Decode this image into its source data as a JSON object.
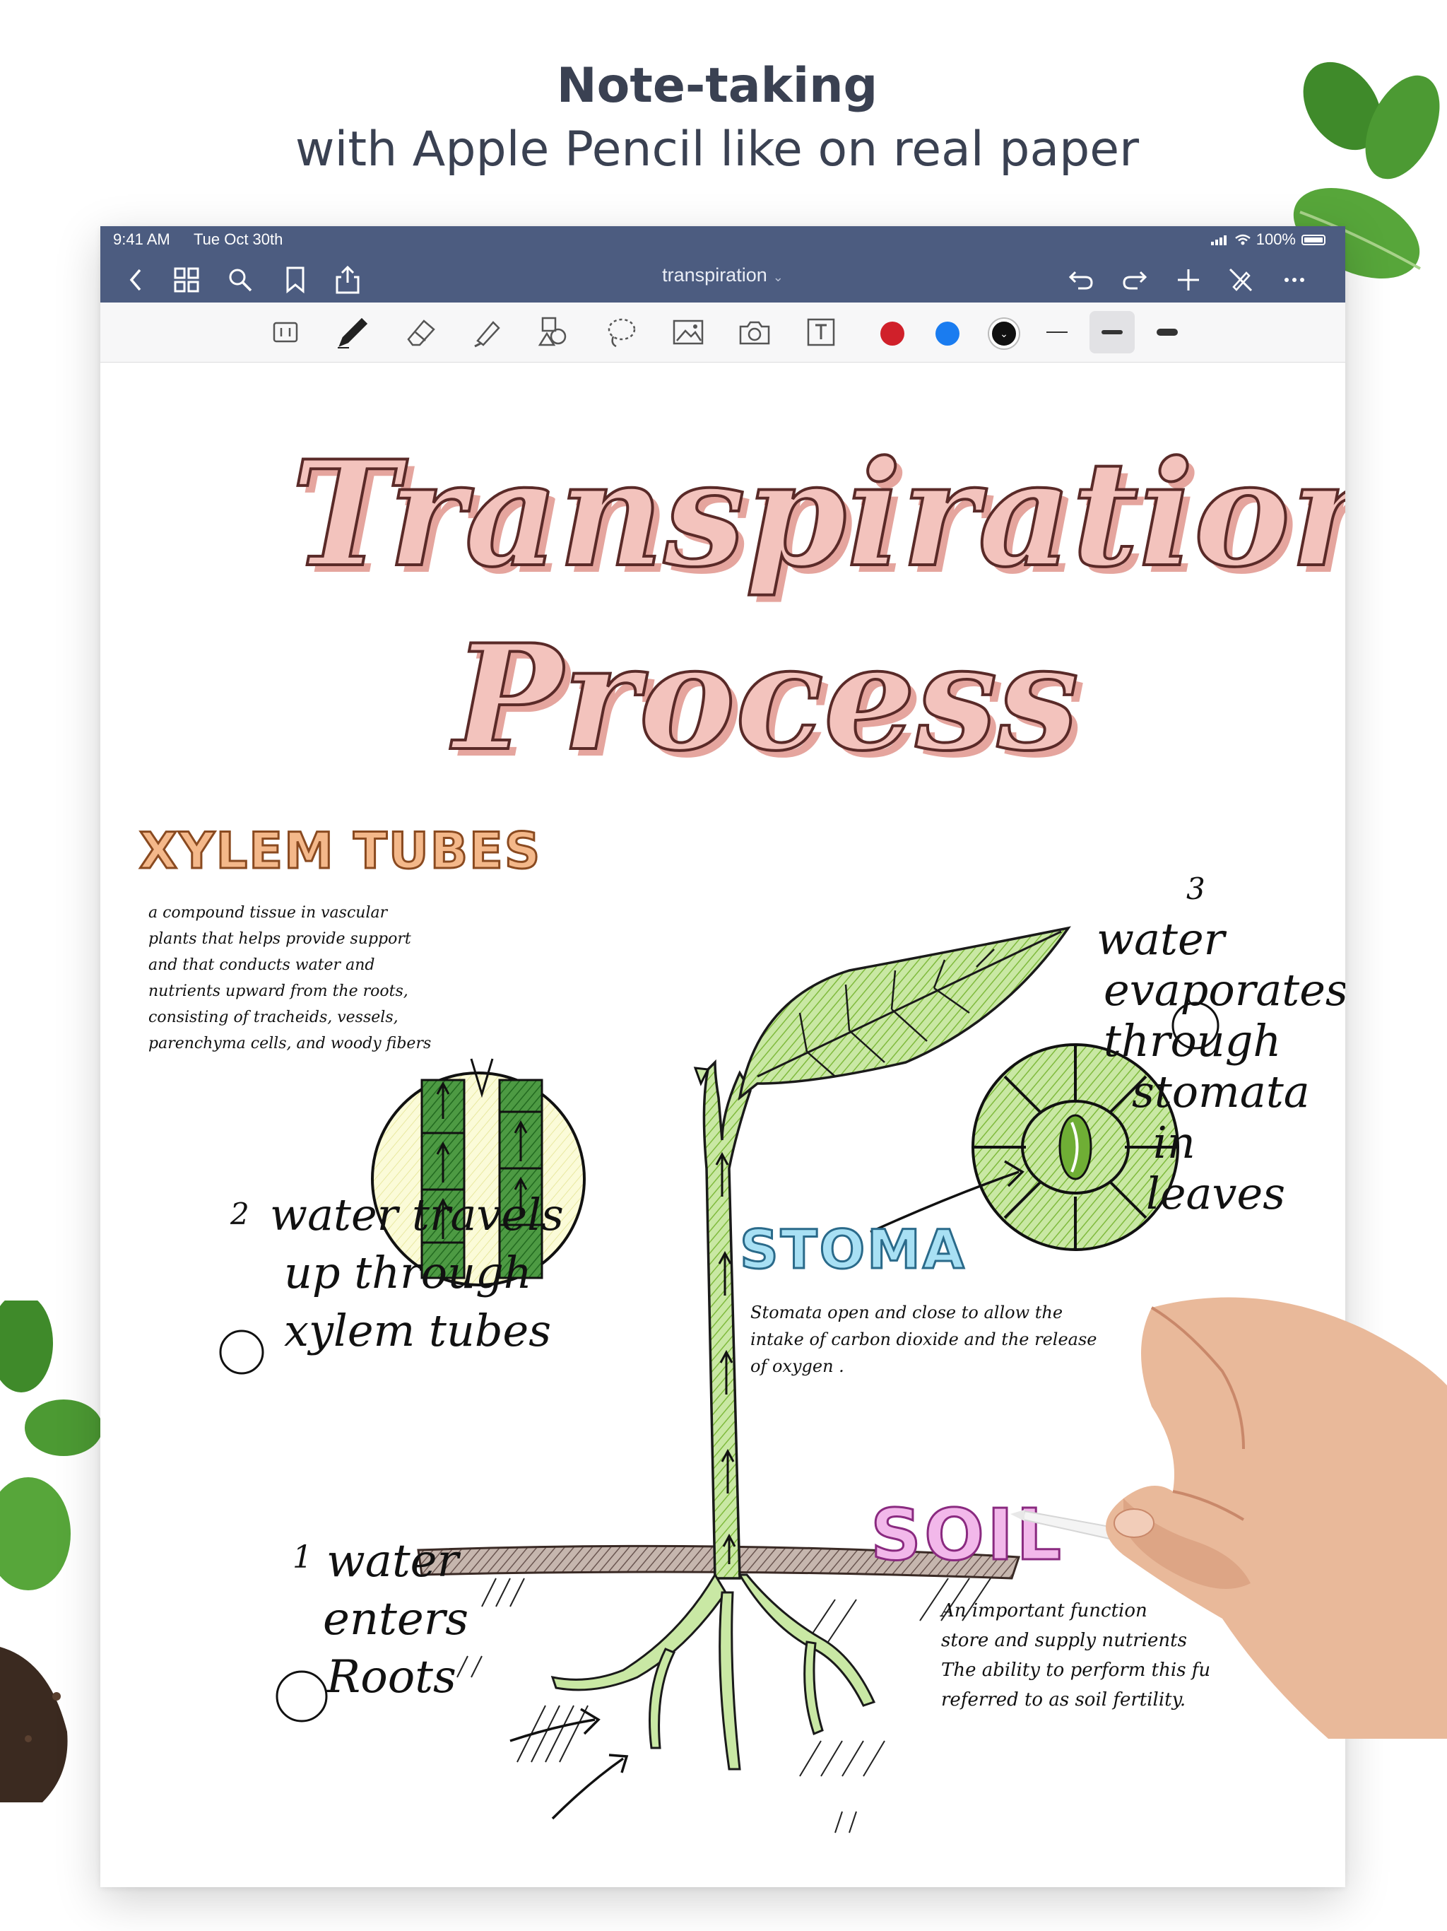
{
  "promo": {
    "title": "Note-taking",
    "subtitle": "with Apple Pencil like on real paper"
  },
  "statusbar": {
    "time": "9:41 AM",
    "date": "Tue Oct 30th",
    "battery": "100%"
  },
  "navbar": {
    "document_title": "transpiration",
    "left_icons": [
      "back-chevron-icon",
      "grid-icon",
      "search-icon",
      "bookmark-icon",
      "share-icon"
    ],
    "right_icons": [
      "undo-icon",
      "redo-icon",
      "add-icon",
      "pen-off-icon",
      "more-icon"
    ]
  },
  "tools": {
    "items": [
      "read-mode-icon",
      "pen-icon",
      "eraser-icon",
      "highlighter-icon",
      "shapes-icon",
      "lasso-icon",
      "image-icon",
      "camera-icon",
      "text-tool-icon"
    ],
    "colors": [
      "#d0202a",
      "#1a7cf0",
      "#111111"
    ],
    "selected_color": "#111111",
    "stroke_widths": [
      "thin",
      "medium",
      "thick"
    ],
    "selected_width": "medium"
  },
  "note": {
    "title_line1": "Transpiration",
    "title_line2": "Process",
    "xylem_heading": "XYLEM TUBES",
    "xylem_text": [
      "a compound tissue in vascular",
      "plants that helps provide support",
      "and that conducts water and",
      "nutrients upward from the roots,",
      "consisting of tracheids, vessels,",
      "parenchyma cells, and woody fibers"
    ],
    "step2_num": "2",
    "step2_text": [
      "water travels",
      "up through",
      "xylem tubes"
    ],
    "step3_num": "3",
    "step3_text": [
      "water",
      "evaporates",
      "through",
      "stomata",
      "in",
      "leaves"
    ],
    "stoma_heading": "STOMA",
    "stoma_text": [
      "Stomata open and close to allow the",
      "intake of carbon dioxide and the release",
      "of oxygen ."
    ],
    "step1_num": "1",
    "step1_text": [
      "water",
      "enters",
      "Roots"
    ],
    "soil_heading": "SOIL",
    "soil_text": [
      "An important function",
      "store and supply nutrients",
      "The ability to perform this fu",
      "referred to as soil fertility."
    ]
  }
}
